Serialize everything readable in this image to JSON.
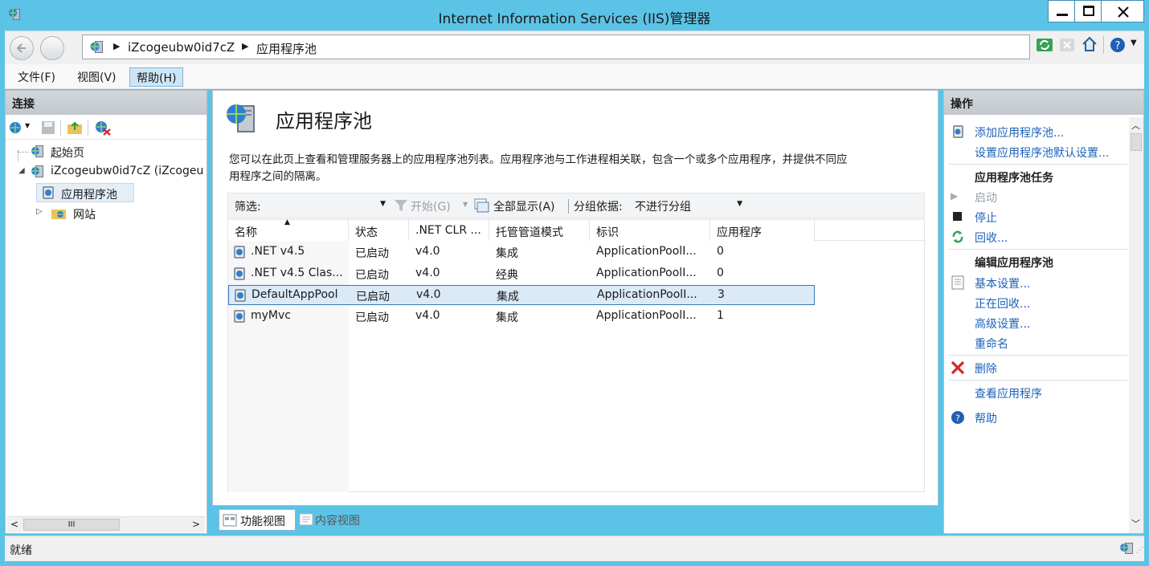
{
  "window": {
    "title": "Internet Information Services (IIS)管理器"
  },
  "address": {
    "segments": [
      "iZcogeubw0id7cZ",
      "应用程序池"
    ]
  },
  "menu": {
    "items": [
      "文件(F)",
      "视图(V)",
      "帮助(H)"
    ]
  },
  "connections": {
    "header": "连接",
    "tree": [
      {
        "label": "起始页"
      },
      {
        "label": "iZcogeubw0id7cZ (iZcogeu"
      },
      {
        "label": "应用程序池"
      },
      {
        "label": "网站"
      }
    ],
    "scroll_label": "III"
  },
  "content": {
    "title": "应用程序池",
    "description_line1": "您可以在此页上查看和管理服务器上的应用程序池列表。应用程序池与工作进程相关联，包含一个或多个应用程序，并提供不同应",
    "description_line2": "用程序之间的隔离。",
    "filter": {
      "label": "筛选:",
      "start": "开始(G)",
      "show_all": "全部显示(A)",
      "group_by_label": "分组依据:",
      "group_by_value": "不进行分组"
    },
    "columns": [
      "名称",
      "状态",
      ".NET CLR ...",
      "托管管道模式",
      "标识",
      "应用程序"
    ],
    "rows": [
      {
        "name": ".NET v4.5",
        "status": "已启动",
        "clr": "v4.0",
        "pipeline": "集成",
        "identity": "ApplicationPoolI...",
        "apps": "0"
      },
      {
        "name": ".NET v4.5 Clas...",
        "status": "已启动",
        "clr": "v4.0",
        "pipeline": "经典",
        "identity": "ApplicationPoolI...",
        "apps": "0"
      },
      {
        "name": "DefaultAppPool",
        "status": "已启动",
        "clr": "v4.0",
        "pipeline": "集成",
        "identity": "ApplicationPoolI...",
        "apps": "3"
      },
      {
        "name": "myMvc",
        "status": "已启动",
        "clr": "v4.0",
        "pipeline": "集成",
        "identity": "ApplicationPoolI...",
        "apps": "1"
      }
    ],
    "selected_row": 2,
    "views": {
      "features": "功能视图",
      "content": "内容视图"
    }
  },
  "actions": {
    "header": "操作",
    "add_pool": "添加应用程序池...",
    "set_defaults": "设置应用程序池默认设置...",
    "tasks_title": "应用程序池任务",
    "start": "启动",
    "stop": "停止",
    "recycle": "回收...",
    "edit_title": "编辑应用程序池",
    "basic_settings": "基本设置...",
    "recycling": "正在回收...",
    "advanced_settings": "高级设置...",
    "rename": "重命名",
    "delete": "删除",
    "view_apps": "查看应用程序",
    "help": "帮助"
  },
  "status": {
    "text": "就绪"
  },
  "colors": {
    "titlebar": "#5bc3e6",
    "link": "#1c62b9",
    "selection": "#dbeaf7"
  }
}
